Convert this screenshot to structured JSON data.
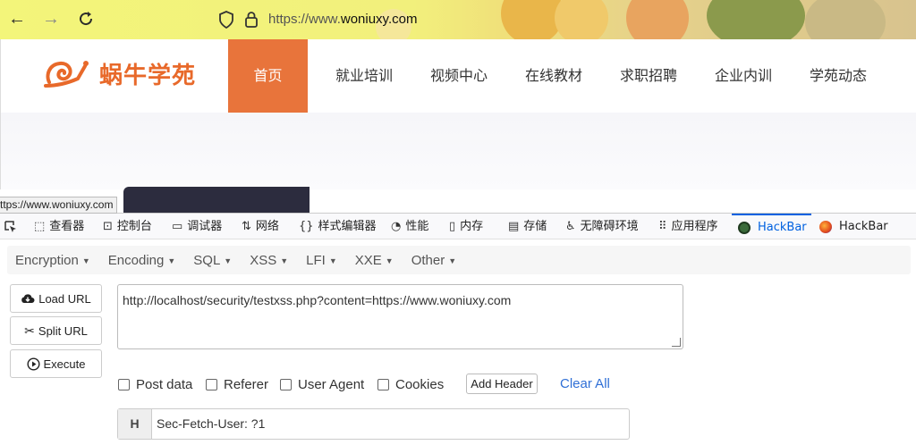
{
  "browser": {
    "url_prefix": "https://www.",
    "url_domain": "woniuxy.com",
    "back_icon": "arrow-left-icon",
    "forward_icon": "arrow-right-icon",
    "reload_icon": "reload-icon"
  },
  "site": {
    "logo_text": "蜗牛学苑",
    "menu": [
      {
        "label": "首页",
        "active": true
      },
      {
        "label": "就业培训"
      },
      {
        "label": "视频中心"
      },
      {
        "label": "在线教材"
      },
      {
        "label": "求职招聘"
      },
      {
        "label": "企业内训"
      },
      {
        "label": "学苑动态"
      }
    ],
    "accent": "#e8743b"
  },
  "status_tip": "ttps://www.woniuxy.com",
  "devtools": {
    "tabs": [
      {
        "label": "查看器",
        "icon": "inspector-icon"
      },
      {
        "label": "控制台",
        "icon": "console-icon"
      },
      {
        "label": "调试器",
        "icon": "debugger-icon"
      },
      {
        "label": "网络",
        "icon": "network-icon"
      },
      {
        "label": "样式编辑器",
        "icon": "style-editor-icon"
      },
      {
        "label": "性能",
        "icon": "performance-icon"
      },
      {
        "label": "内存",
        "icon": "memory-icon"
      },
      {
        "label": "存储",
        "icon": "storage-icon"
      },
      {
        "label": "无障碍环境",
        "icon": "accessibility-icon"
      },
      {
        "label": "应用程序",
        "icon": "application-icon"
      },
      {
        "label": "HackBar",
        "icon": "hackbar-icon",
        "active": true
      },
      {
        "label": "HackBar",
        "icon": "hackbar-firefox-icon"
      }
    ]
  },
  "hackbar": {
    "menu": [
      "Encryption",
      "Encoding",
      "SQL",
      "XSS",
      "LFI",
      "XXE",
      "Other"
    ],
    "buttons": {
      "load": "Load URL",
      "split": "Split URL",
      "execute": "Execute"
    },
    "url_value": "http://localhost/security/testxss.php?content=https://www.woniuxy.com",
    "options": [
      "Post data",
      "Referer",
      "User Agent",
      "Cookies"
    ],
    "add_header": "Add Header",
    "clear_all": "Clear All",
    "header": {
      "tag": "H",
      "value": "Sec-Fetch-User: ?1"
    }
  }
}
